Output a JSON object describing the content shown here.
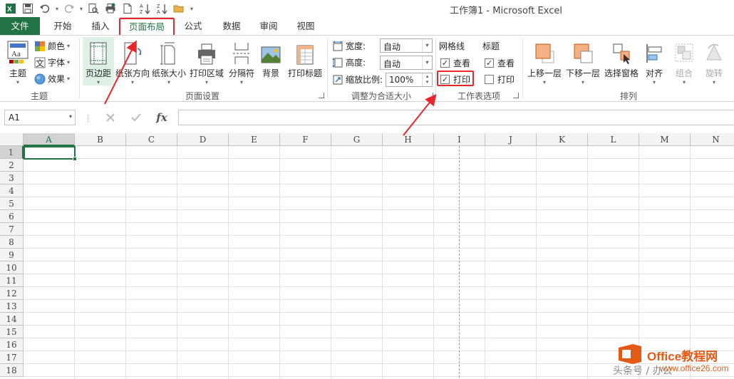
{
  "window": {
    "title": "工作簿1 - Microsoft Excel"
  },
  "tabs": [
    {
      "label": "文件"
    },
    {
      "label": "开始"
    },
    {
      "label": "插入"
    },
    {
      "label": "页面布局"
    },
    {
      "label": "公式"
    },
    {
      "label": "数据"
    },
    {
      "label": "审阅"
    },
    {
      "label": "视图"
    }
  ],
  "ribbon": {
    "theme_group": {
      "label": "主题",
      "theme_button": "主题",
      "colors": "颜色",
      "fonts": "字体",
      "effects": "效果"
    },
    "page_setup_group": {
      "label": "页面设置",
      "margins": "页边距",
      "orientation": "纸张方向",
      "size": "纸张大小",
      "print_area": "打印区域",
      "breaks": "分隔符",
      "background": "背景",
      "print_titles": "打印标题"
    },
    "scale_group": {
      "label": "调整为合适大小",
      "width_label": "宽度:",
      "width_value": "自动",
      "height_label": "高度:",
      "height_value": "自动",
      "scale_label": "缩放比例:",
      "scale_value": "100%"
    },
    "sheet_options_group": {
      "label": "工作表选项",
      "gridlines_header": "网格线",
      "gridlines_view": "查看",
      "gridlines_print": "打印",
      "headings_header": "标题",
      "headings_view": "查看",
      "headings_print": "打印"
    },
    "arrange_group": {
      "label": "排列",
      "bring_forward": "上移一层",
      "send_backward": "下移一层",
      "selection_pane": "选择窗格",
      "align": "对齐",
      "group": "组合",
      "rotate": "旋转"
    }
  },
  "formula_bar": {
    "name_box": "A1",
    "fx": "fx",
    "value": ""
  },
  "grid": {
    "columns": [
      "A",
      "B",
      "C",
      "D",
      "E",
      "F",
      "G",
      "H",
      "I",
      "J",
      "K",
      "L",
      "M",
      "N"
    ],
    "rows": [
      "1",
      "2",
      "3",
      "4",
      "5",
      "6",
      "7",
      "8",
      "9",
      "10",
      "11",
      "12",
      "13",
      "14",
      "15",
      "16",
      "17",
      "18"
    ]
  },
  "watermark": {
    "brand": "Office教程网",
    "url": "www.office26.com",
    "sub": "头条号 / 办公"
  },
  "colors": {
    "excel_green": "#217346",
    "highlight_red": "#e8262b",
    "brand_orange": "#e45a14"
  }
}
